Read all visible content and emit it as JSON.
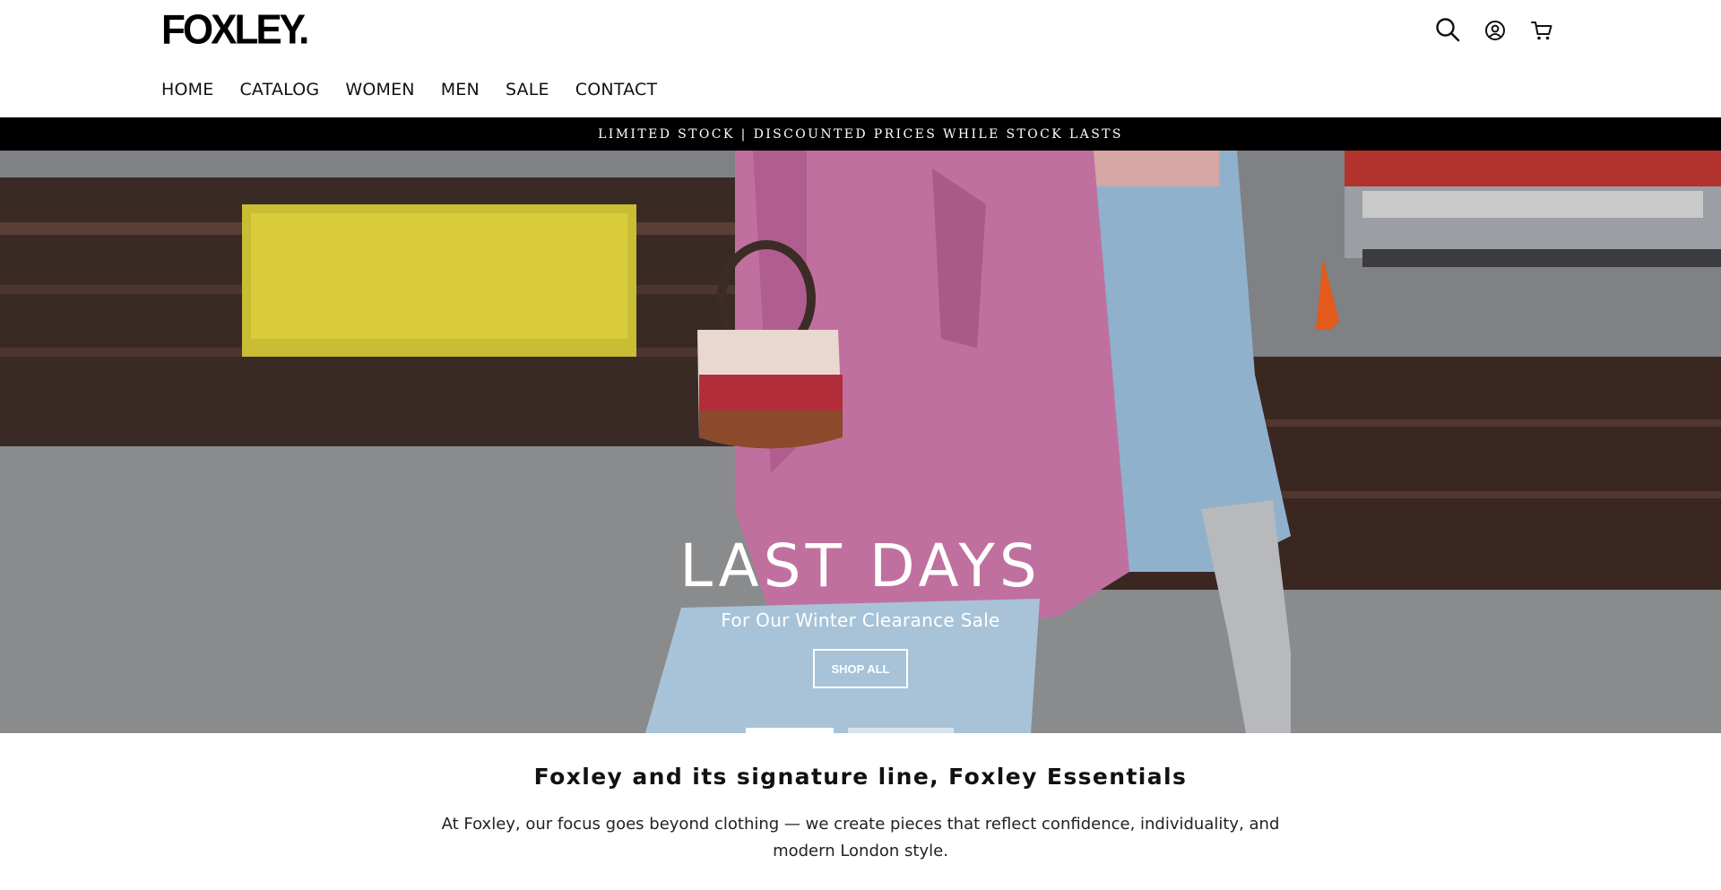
{
  "header": {
    "logo_text": "FOXLEY.",
    "icons": [
      "search-icon",
      "account-icon",
      "cart-icon"
    ]
  },
  "nav": {
    "items": [
      {
        "label": "HOME"
      },
      {
        "label": "CATALOG"
      },
      {
        "label": "WOMEN"
      },
      {
        "label": "MEN"
      },
      {
        "label": "SALE"
      },
      {
        "label": "CONTACT"
      }
    ]
  },
  "announcement": {
    "text": "LIMITED STOCK | DISCOUNTED PRICES WHILE STOCK LASTS"
  },
  "hero": {
    "title": "LAST DAYS",
    "subtitle": "For Our Winter Clearance Sale",
    "button_label": "SHOP ALL",
    "slide_count": 2,
    "active_slide": 1
  },
  "intro": {
    "title": "Foxley and its signature line, Foxley Essentials",
    "paragraph": "At Foxley, our focus goes beyond clothing — we create pieces that reflect confidence, individuality, and modern London style."
  },
  "colors": {
    "announcement_bg": "#000000",
    "text": "#111111",
    "hero_text": "#ffffff"
  }
}
